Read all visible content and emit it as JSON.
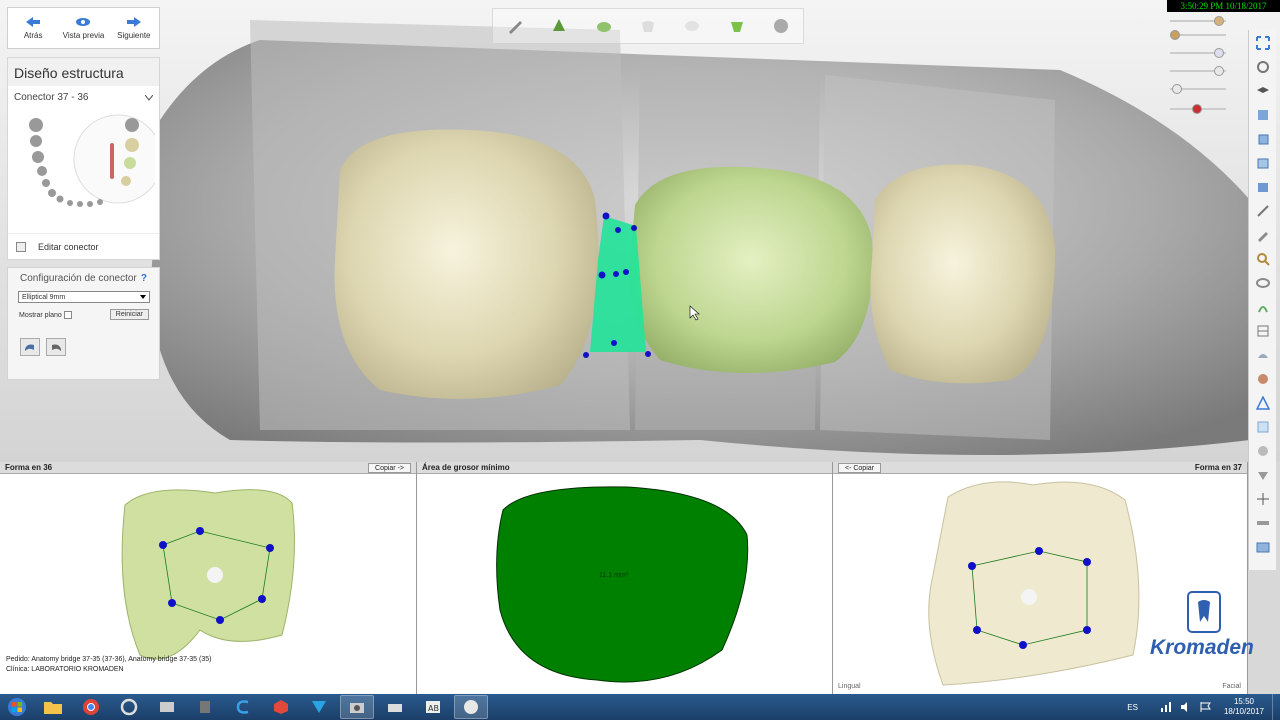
{
  "nav": {
    "back": "Atrás",
    "preview": "Vista previa",
    "next": "Siguiente"
  },
  "design_panel": {
    "title": "Diseño estructura",
    "connector": "Conector 37 - 36",
    "edit_connector": "Editar conector"
  },
  "config": {
    "title": "Configuración de conector",
    "help": "?",
    "shape": "Elliptical 9mm",
    "show_plane": "Mostrar plano",
    "reset": "Reiniciar"
  },
  "clock": "3:50:29 PM 10/18/2017",
  "panels": {
    "left": {
      "title": "Forma en 36",
      "copy": "Copiar ->"
    },
    "middle": {
      "title": "Área de grosor mínimo",
      "area_label": "11.1 mm²"
    },
    "right": {
      "title": "Forma en 37",
      "copy": "<- Copiar",
      "lingual": "Lingual",
      "facial": "Facial"
    }
  },
  "order_info": {
    "pedido_label": "Pedido:",
    "pedido_value": "Anatomy bridge 37-35 (37-36), Anatomy bridge 37-35 (35)",
    "clinica_label": "Clínica:",
    "clinica_value": "LABORATORIO KROMADEN"
  },
  "watermark": "Kromaden",
  "taskbar": {
    "apps": [
      "folder-icon",
      "chrome-icon",
      "opera-icon",
      "explorer-icon",
      "tool-icon",
      "c-icon",
      "cube-icon",
      "vector-icon",
      "camera-icon",
      "scanner-icon",
      "ab-icon",
      "tooth-app-icon"
    ],
    "lang": "ES",
    "time": "15:50",
    "date": "18/10/2017"
  },
  "colors": {
    "accent_green": "#00a000",
    "connector": "#22e39a",
    "control_point": "#1010c8",
    "tooth_cream": "#e9e4c6",
    "tooth_green": "#c8dd9a",
    "taskbar": "#1e4a7a"
  }
}
